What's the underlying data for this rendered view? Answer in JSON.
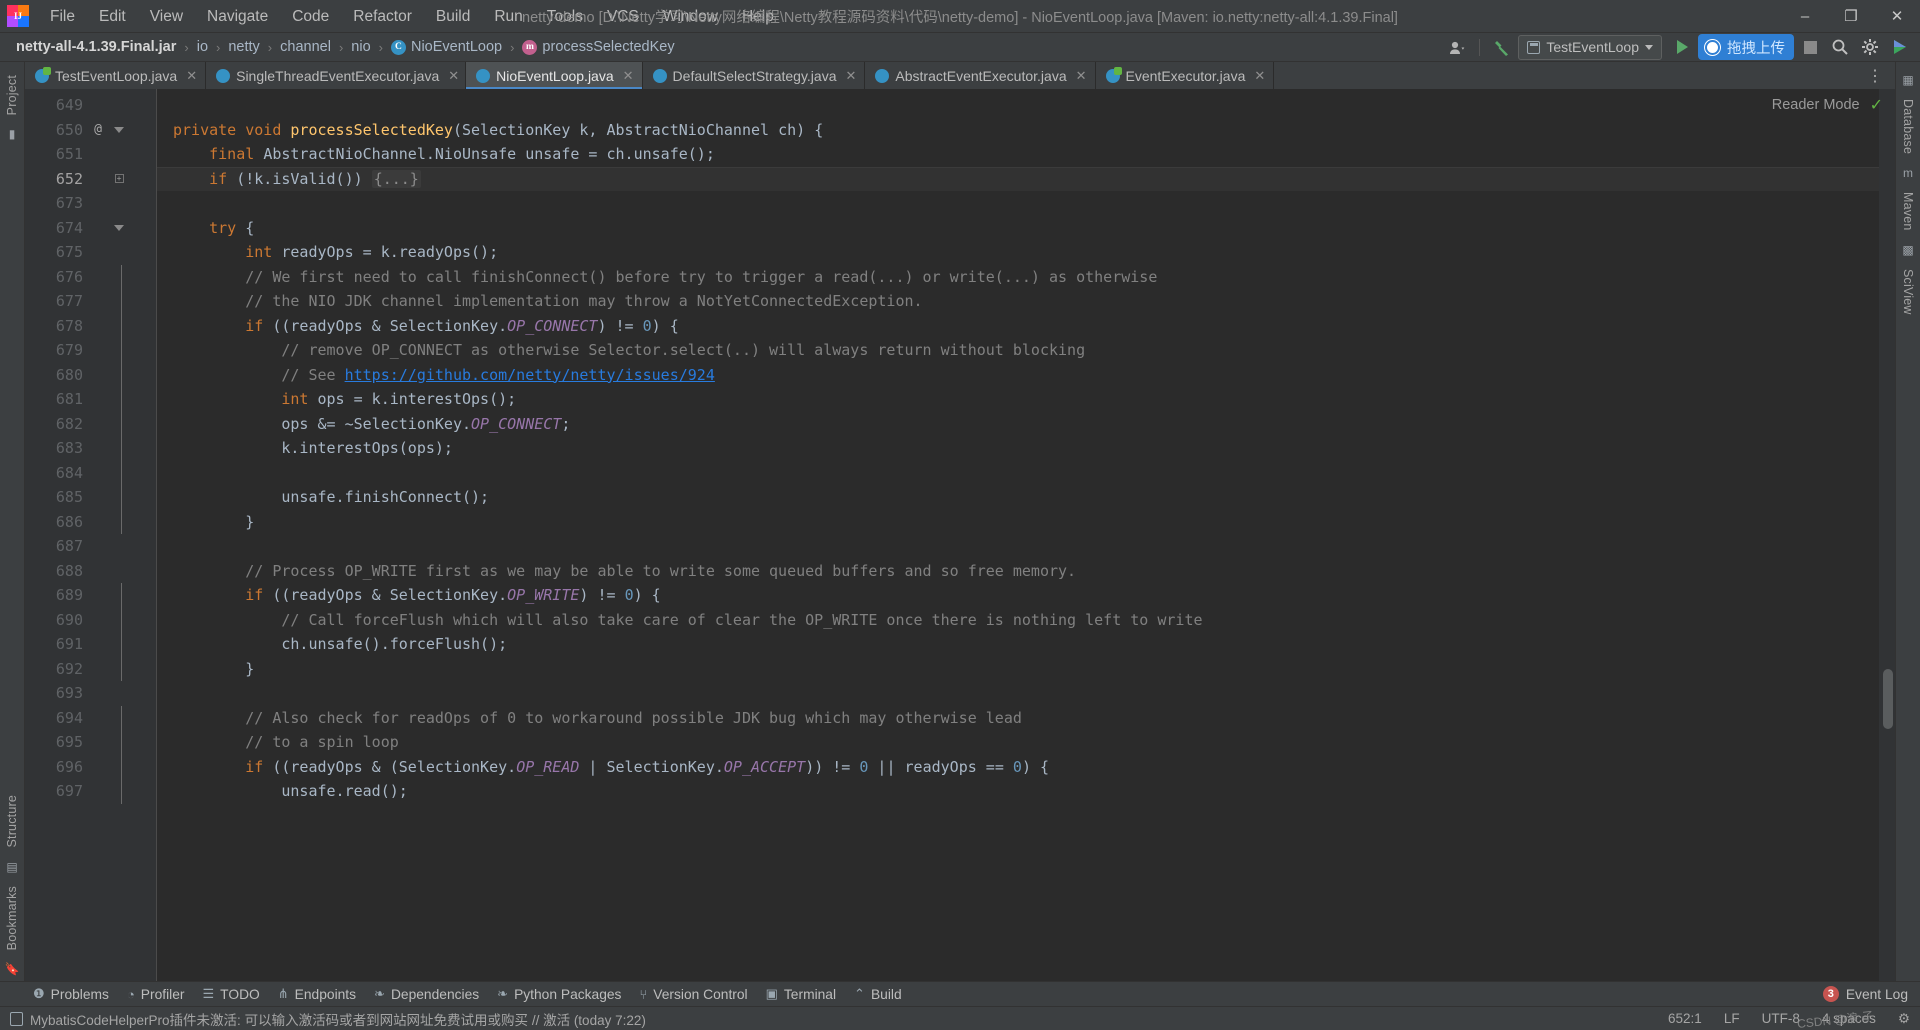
{
  "window": {
    "title": "netty-demo [D:\\Netty学习\\Netty网络编程\\Netty教程源码资料\\代码\\netty-demo] - NioEventLoop.java [Maven: io.netty:netty-all:4.1.39.Final]",
    "minimize": "–",
    "maximize": "❐",
    "close": "✕"
  },
  "menu": {
    "items": [
      {
        "label": "File"
      },
      {
        "label": "Edit"
      },
      {
        "label": "View"
      },
      {
        "label": "Navigate"
      },
      {
        "label": "Code"
      },
      {
        "label": "Refactor"
      },
      {
        "label": "Build"
      },
      {
        "label": "Run"
      },
      {
        "label": "Tools"
      },
      {
        "label": "VCS"
      },
      {
        "label": "Window"
      },
      {
        "label": "Help"
      }
    ]
  },
  "breadcrumb": {
    "sep": "›",
    "items": [
      {
        "label": "netty-all-4.1.39.Final.jar",
        "icon": "jar-icon"
      },
      {
        "label": "io",
        "icon": "package-icon"
      },
      {
        "label": "netty",
        "icon": "package-icon"
      },
      {
        "label": "channel",
        "icon": "package-icon"
      },
      {
        "label": "nio",
        "icon": "package-icon"
      },
      {
        "label": "NioEventLoop",
        "icon": "class-icon",
        "badge": "C"
      },
      {
        "label": "processSelectedKey",
        "icon": "method-icon",
        "badge": "m"
      }
    ]
  },
  "toolbar": {
    "run_configuration": "TestEventLoop",
    "upload_button": "拖拽上传",
    "search_icon": "search-icon",
    "settings_icon": "gear-icon",
    "profile_icon": "user-icon",
    "hammer_icon": "build-hammer-icon"
  },
  "tabs": [
    {
      "label": "TestEventLoop.java",
      "active": false,
      "icon": "java-class-icon"
    },
    {
      "label": "SingleThreadEventExecutor.java",
      "active": false,
      "icon": "java-class-icon"
    },
    {
      "label": "NioEventLoop.java",
      "active": true,
      "icon": "java-class-icon"
    },
    {
      "label": "DefaultSelectStrategy.java",
      "active": false,
      "icon": "java-class-icon"
    },
    {
      "label": "AbstractEventExecutor.java",
      "active": false,
      "icon": "java-class-icon"
    },
    {
      "label": "EventExecutor.java",
      "active": false,
      "icon": "java-interface-icon"
    }
  ],
  "editor": {
    "reader_mode_label": "Reader Mode",
    "lines": [
      {
        "n": "649",
        "ann": "",
        "fold": "",
        "indent": 0,
        "tokens": [],
        "hl": false
      },
      {
        "n": "650",
        "ann": "@",
        "fold": "arrow",
        "indent": 0,
        "hl": false,
        "tokens": [
          {
            "t": "kw",
            "v": "private void "
          },
          {
            "t": "mdecl",
            "v": "processSelectedKey"
          },
          {
            "t": "pln",
            "v": "(SelectionKey k, AbstractNioChannel ch) {"
          }
        ]
      },
      {
        "n": "651",
        "ann": "",
        "fold": "",
        "indent": 0,
        "hl": false,
        "tokens": [
          {
            "t": "pln",
            "v": "    "
          },
          {
            "t": "kw",
            "v": "final "
          },
          {
            "t": "pln",
            "v": "AbstractNioChannel.NioUnsafe unsafe = ch.unsafe();"
          }
        ]
      },
      {
        "n": "652",
        "ann": "",
        "fold": "plus",
        "indent": 0,
        "hl": true,
        "tokens": [
          {
            "t": "pln",
            "v": "    "
          },
          {
            "t": "kw",
            "v": "if "
          },
          {
            "t": "pln",
            "v": "(!k.isValid()) "
          },
          {
            "t": "fold-ph",
            "v": "{...}"
          }
        ]
      },
      {
        "n": "673",
        "ann": "",
        "fold": "",
        "indent": 0,
        "tokens": [],
        "hl": false
      },
      {
        "n": "674",
        "ann": "",
        "fold": "arrow",
        "indent": 0,
        "hl": false,
        "tokens": [
          {
            "t": "pln",
            "v": "    "
          },
          {
            "t": "kw",
            "v": "try "
          },
          {
            "t": "pln",
            "v": "{"
          }
        ]
      },
      {
        "n": "675",
        "ann": "",
        "fold": "",
        "indent": 0,
        "hl": false,
        "tokens": [
          {
            "t": "pln",
            "v": "        "
          },
          {
            "t": "kw",
            "v": "int "
          },
          {
            "t": "pln",
            "v": "readyOps = k.readyOps();"
          }
        ]
      },
      {
        "n": "676",
        "ann": "",
        "fold": "bar",
        "indent": 0,
        "hl": false,
        "tokens": [
          {
            "t": "cmt",
            "v": "        // We first need to call finishConnect() before try to trigger a read(...) or write(...) as otherwise"
          }
        ]
      },
      {
        "n": "677",
        "ann": "",
        "fold": "bar",
        "indent": 0,
        "hl": false,
        "tokens": [
          {
            "t": "cmt",
            "v": "        // the NIO JDK channel implementation may throw a NotYetConnectedException."
          }
        ]
      },
      {
        "n": "678",
        "ann": "",
        "fold": "bar",
        "indent": 0,
        "hl": false,
        "tokens": [
          {
            "t": "pln",
            "v": "        "
          },
          {
            "t": "kw",
            "v": "if "
          },
          {
            "t": "pln",
            "v": "((readyOps & SelectionKey."
          },
          {
            "t": "cst",
            "v": "OP_CONNECT"
          },
          {
            "t": "pln",
            "v": ") != "
          },
          {
            "t": "num",
            "v": "0"
          },
          {
            "t": "pln",
            "v": ") {"
          }
        ]
      },
      {
        "n": "679",
        "ann": "",
        "fold": "bar",
        "indent": 0,
        "hl": false,
        "tokens": [
          {
            "t": "cmt",
            "v": "            // remove OP_CONNECT as otherwise Selector.select(..) will always return without blocking"
          }
        ]
      },
      {
        "n": "680",
        "ann": "",
        "fold": "bar",
        "indent": 0,
        "hl": false,
        "tokens": [
          {
            "t": "cmt",
            "v": "            // See "
          },
          {
            "t": "lnk",
            "v": "https://github.com/netty/netty/issues/924"
          }
        ]
      },
      {
        "n": "681",
        "ann": "",
        "fold": "bar",
        "indent": 0,
        "hl": false,
        "tokens": [
          {
            "t": "pln",
            "v": "            "
          },
          {
            "t": "kw",
            "v": "int "
          },
          {
            "t": "pln",
            "v": "ops = k.interestOps();"
          }
        ]
      },
      {
        "n": "682",
        "ann": "",
        "fold": "bar",
        "indent": 0,
        "hl": false,
        "tokens": [
          {
            "t": "pln",
            "v": "            ops &= ~SelectionKey."
          },
          {
            "t": "cst",
            "v": "OP_CONNECT"
          },
          {
            "t": "pln",
            "v": ";"
          }
        ]
      },
      {
        "n": "683",
        "ann": "",
        "fold": "bar",
        "indent": 0,
        "hl": false,
        "tokens": [
          {
            "t": "pln",
            "v": "            k.interestOps(ops);"
          }
        ]
      },
      {
        "n": "684",
        "ann": "",
        "fold": "bar",
        "indent": 0,
        "tokens": [],
        "hl": false
      },
      {
        "n": "685",
        "ann": "",
        "fold": "bar",
        "indent": 0,
        "hl": false,
        "tokens": [
          {
            "t": "pln",
            "v": "            unsafe.finishConnect();"
          }
        ]
      },
      {
        "n": "686",
        "ann": "",
        "fold": "bar",
        "indent": 0,
        "hl": false,
        "tokens": [
          {
            "t": "pln",
            "v": "        }"
          }
        ]
      },
      {
        "n": "687",
        "ann": "",
        "fold": "",
        "indent": 0,
        "tokens": [],
        "hl": false
      },
      {
        "n": "688",
        "ann": "",
        "fold": "",
        "indent": 0,
        "hl": false,
        "tokens": [
          {
            "t": "cmt",
            "v": "        // Process OP_WRITE first as we may be able to write some queued buffers and so free memory."
          }
        ]
      },
      {
        "n": "689",
        "ann": "",
        "fold": "bar",
        "indent": 0,
        "hl": false,
        "tokens": [
          {
            "t": "pln",
            "v": "        "
          },
          {
            "t": "kw",
            "v": "if "
          },
          {
            "t": "pln",
            "v": "((readyOps & SelectionKey."
          },
          {
            "t": "cst",
            "v": "OP_WRITE"
          },
          {
            "t": "pln",
            "v": ") != "
          },
          {
            "t": "num",
            "v": "0"
          },
          {
            "t": "pln",
            "v": ") {"
          }
        ]
      },
      {
        "n": "690",
        "ann": "",
        "fold": "bar",
        "indent": 0,
        "hl": false,
        "tokens": [
          {
            "t": "cmt",
            "v": "            // Call forceFlush which will also take care of clear the OP_WRITE once there is nothing left to write"
          }
        ]
      },
      {
        "n": "691",
        "ann": "",
        "fold": "bar",
        "indent": 0,
        "hl": false,
        "tokens": [
          {
            "t": "pln",
            "v": "            ch.unsafe().forceFlush();"
          }
        ]
      },
      {
        "n": "692",
        "ann": "",
        "fold": "bar",
        "indent": 0,
        "hl": false,
        "tokens": [
          {
            "t": "pln",
            "v": "        }"
          }
        ]
      },
      {
        "n": "693",
        "ann": "",
        "fold": "",
        "indent": 0,
        "tokens": [],
        "hl": false
      },
      {
        "n": "694",
        "ann": "",
        "fold": "bar",
        "indent": 0,
        "hl": false,
        "tokens": [
          {
            "t": "cmt",
            "v": "        // Also check for readOps of 0 to workaround possible JDK bug which may otherwise lead"
          }
        ]
      },
      {
        "n": "695",
        "ann": "",
        "fold": "bar",
        "indent": 0,
        "hl": false,
        "tokens": [
          {
            "t": "cmt",
            "v": "        // to a spin loop"
          }
        ]
      },
      {
        "n": "696",
        "ann": "",
        "fold": "bar",
        "indent": 0,
        "hl": false,
        "tokens": [
          {
            "t": "pln",
            "v": "        "
          },
          {
            "t": "kw",
            "v": "if "
          },
          {
            "t": "pln",
            "v": "((readyOps & (SelectionKey."
          },
          {
            "t": "cst",
            "v": "OP_READ"
          },
          {
            "t": "pln",
            "v": " | SelectionKey."
          },
          {
            "t": "cst",
            "v": "OP_ACCEPT"
          },
          {
            "t": "pln",
            "v": ")) != "
          },
          {
            "t": "num",
            "v": "0"
          },
          {
            "t": "pln",
            "v": " || readyOps == "
          },
          {
            "t": "num",
            "v": "0"
          },
          {
            "t": "pln",
            "v": ") {"
          }
        ]
      },
      {
        "n": "697",
        "ann": "",
        "fold": "bar",
        "indent": 0,
        "hl": false,
        "tokens": [
          {
            "t": "pln",
            "v": "            unsafe.read();"
          }
        ]
      }
    ]
  },
  "left_rail": {
    "top": [
      {
        "label": "Project"
      }
    ],
    "bottom": [
      {
        "label": "Structure"
      },
      {
        "label": "Bookmarks"
      }
    ]
  },
  "right_rail": {
    "items": [
      {
        "label": "Database"
      },
      {
        "label": "Maven"
      },
      {
        "label": "SciView"
      }
    ]
  },
  "bottom_tools": [
    {
      "label": "Problems",
      "icon": "problems-icon"
    },
    {
      "label": "Profiler",
      "icon": "profiler-icon"
    },
    {
      "label": "TODO",
      "icon": "todo-icon"
    },
    {
      "label": "Endpoints",
      "icon": "endpoints-icon"
    },
    {
      "label": "Dependencies",
      "icon": "dependencies-icon"
    },
    {
      "label": "Python Packages",
      "icon": "python-packages-icon"
    },
    {
      "label": "Version Control",
      "icon": "version-control-icon"
    },
    {
      "label": "Terminal",
      "icon": "terminal-icon"
    },
    {
      "label": "Build",
      "icon": "build-hammer-icon"
    }
  ],
  "event_log": {
    "label": "Event Log",
    "count": "3"
  },
  "statusbar": {
    "message": "MybatisCodeHelperPro插件未激活: 可以输入激活码或者到网站网址免费试用或购买 // 激活 (today 7:22)",
    "caret": "652:1",
    "line_separator": "LF",
    "encoding": "UTF-8",
    "indent": "4 spaces",
    "lock_icon": "lock-icon"
  },
  "watermark": "CSDN @浪.子",
  "colors": {
    "accent": "#4a88c7",
    "keyword": "#cc7832",
    "comment": "#808080",
    "number": "#6897bb",
    "constant": "#9876aa",
    "method": "#ffc66d",
    "text": "#a9b7c6",
    "editor_bg": "#2b2b2b",
    "panel_bg": "#3c3f41",
    "link": "#287bde",
    "upload_blue": "#2f7fd4",
    "badge_red": "#c75450"
  }
}
